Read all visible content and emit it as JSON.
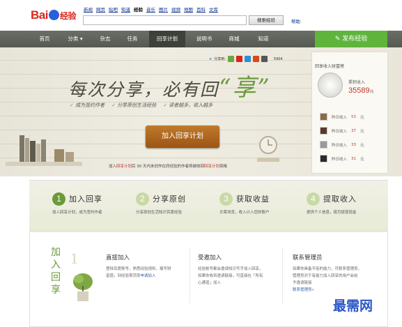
{
  "logo": {
    "brand": "Bai",
    "brand2": "du",
    "product": "经验"
  },
  "top_links": [
    "新闻",
    "网页",
    "贴吧",
    "知道",
    "经验",
    "音乐",
    "图片",
    "视频",
    "地图",
    "百科",
    "文库"
  ],
  "top_links_current": "经验",
  "search": {
    "button": "搜索经验",
    "help": "帮助"
  },
  "nav": [
    "首页",
    "分类",
    "杂志",
    "任务",
    "回享计划",
    "说明书",
    "商城",
    "知道"
  ],
  "nav_dropdown": "▾",
  "publish": "发布经验",
  "share": {
    "label": "分享到:",
    "count": "5904"
  },
  "banner": {
    "slogan_a": "每次分享，必有回",
    "slogan_b": "“享”",
    "points": [
      "成为签约作者",
      "分享原创生活经验",
      "读者越多，收入越多"
    ],
    "join_button": "加入回享计划",
    "tagline_a": "加入",
    "tagline_b": "回享计划",
    "tagline_c": "后 30 天内未创作在同经验的作者将被收回",
    "tagline_d": "回享计划",
    "tagline_e": "资格"
  },
  "income_card": {
    "title": "回享收入财富榜",
    "cum_label": "累积收入",
    "cum_value": "35589",
    "unit": "元",
    "rows": [
      {
        "label": "昨日收入",
        "value": "53",
        "unit": "元"
      },
      {
        "label": "昨日收入",
        "value": "37",
        "unit": "元"
      },
      {
        "label": "昨日收入",
        "value": "33",
        "unit": "元"
      },
      {
        "label": "昨日收入",
        "value": "31",
        "unit": "元"
      }
    ]
  },
  "steps": [
    {
      "num": "1",
      "title": "加入回享",
      "desc": "加入回享计划，成为签约作者"
    },
    {
      "num": "2",
      "title": "分享原创",
      "desc": "分享原创生活知识百度经验"
    },
    {
      "num": "3",
      "title": "获取收益",
      "desc": "文章浏览，收入计入您的账户"
    },
    {
      "num": "4",
      "title": "提取收入",
      "desc": "提供个人信息，按月提现现金"
    }
  ],
  "join_section": {
    "vertical_title": [
      "加",
      "入",
      "回",
      "享"
    ],
    "num": "1",
    "direct": {
      "title": "直接加入",
      "text1": "登陆百度账号，熟悉经验规则，撰写财",
      "text2": "富值，到经验首页即",
      "link": "申请加入",
      "text3": ""
    },
    "invited": {
      "title": "受邀加入",
      "text1": "经验帐号都会邀请知识写手加入回享，",
      "text2": "如果你收到邀请链接，可直接在「所有",
      "text3": "心通道」加入"
    },
    "contact": {
      "title": "联系管理员",
      "text1": "如果你具备不俗的能力，可联系管理员，",
      "text2": "管理员对于有能力加入回享的用户会给",
      "text3": "予邀请链接",
      "link": "联系管理员"
    }
  },
  "watermark": "最需网"
}
